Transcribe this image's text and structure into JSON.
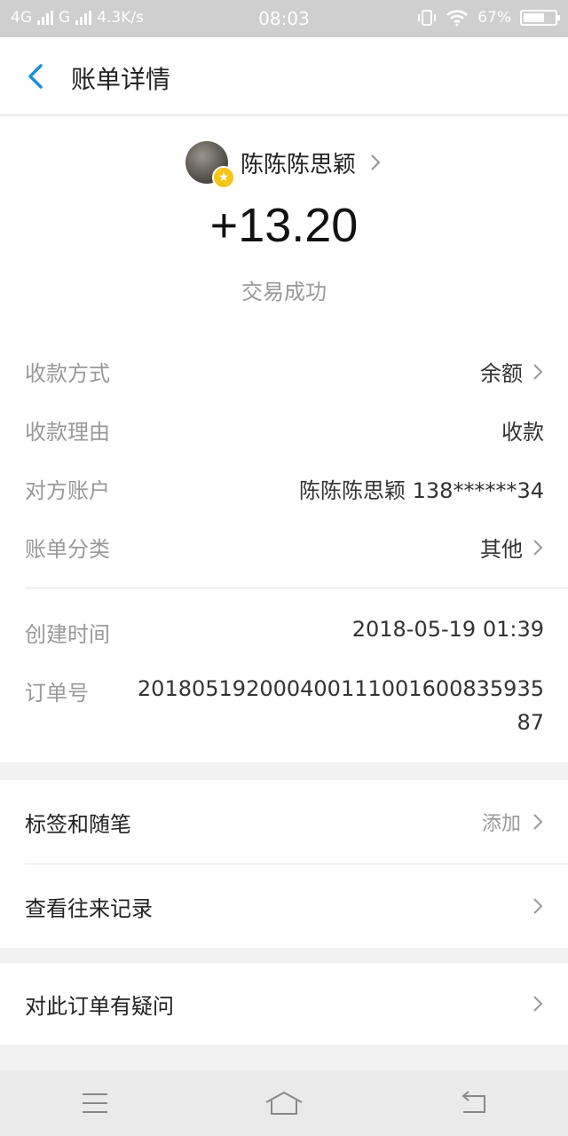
{
  "status_bar": {
    "network1": "4G",
    "network2": "G",
    "speed": "4.3K/s",
    "time": "08:03",
    "battery_text": "67%",
    "battery_level": 0.67
  },
  "header": {
    "title": "账单详情"
  },
  "payer": {
    "name": "陈陈陈思颖"
  },
  "transaction": {
    "amount": "+13.20",
    "status": "交易成功"
  },
  "details": {
    "method_label": "收款方式",
    "method_value": "余额",
    "reason_label": "收款理由",
    "reason_value": "收款",
    "account_label": "对方账户",
    "account_value": "陈陈陈思颖 138******34",
    "category_label": "账单分类",
    "category_value": "其他",
    "created_label": "创建时间",
    "created_value": "2018-05-19 01:39",
    "order_label": "订单号",
    "order_value": "20180519200040011100160083593587"
  },
  "actions": {
    "tags_label": "标签和随笔",
    "tags_action": "添加",
    "history_label": "查看往来记录",
    "question_label": "对此订单有疑问"
  },
  "colors": {
    "accent": "#1a8fdb",
    "badge": "#f5c518"
  }
}
